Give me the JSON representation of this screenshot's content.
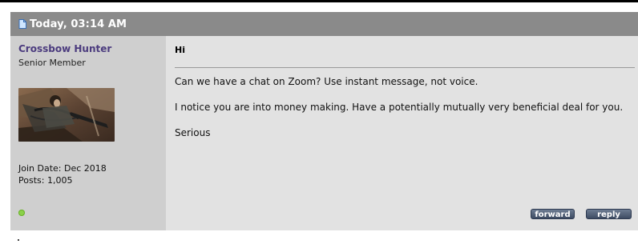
{
  "post": {
    "date": "Today, 03:14 AM"
  },
  "user": {
    "name": "Crossbow Hunter",
    "title": "Senior Member",
    "join_date": "Join Date: Dec 2018",
    "posts": "Posts: 1,005",
    "status_color": "#8bd14a"
  },
  "message": {
    "title": "Hi",
    "paragraphs": [
      "Can we have a chat on Zoom? Use instant message, not voice.",
      "I notice you are into money making. Have a potentially mutually very beneficial deal for you.",
      "Serious"
    ]
  },
  "buttons": {
    "forward": "forward",
    "reply": "reply"
  },
  "colors": {
    "header_bg": "#8a8a8a",
    "username": "#4b3b7e",
    "user_panel_bg": "#cfcfcf",
    "message_bg": "#e2e2e2"
  }
}
